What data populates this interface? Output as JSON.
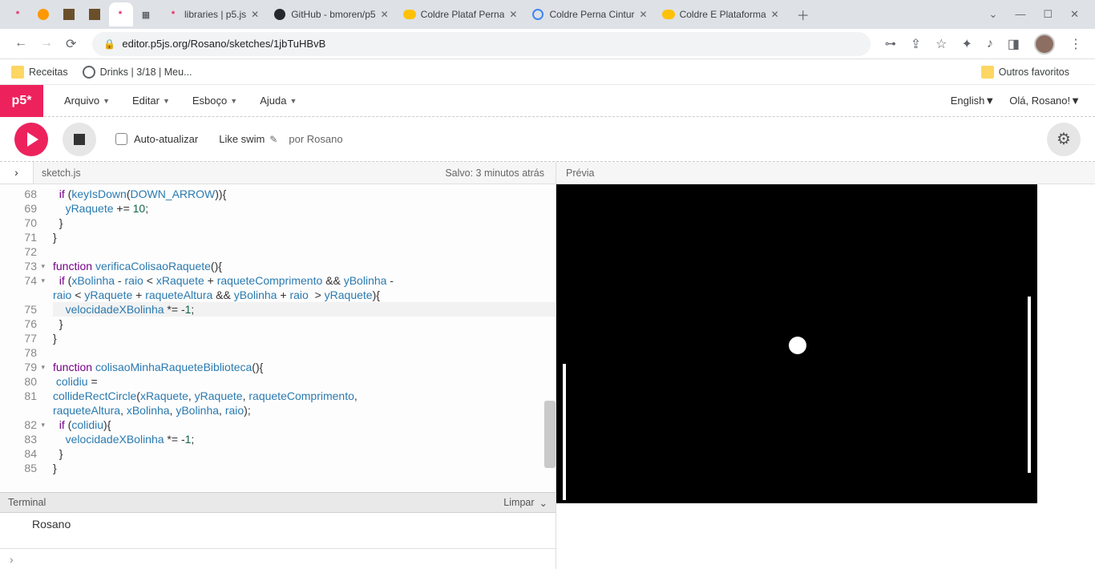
{
  "browser": {
    "tabs": [
      {
        "title": "",
        "fav": "pink"
      },
      {
        "title": "",
        "fav": "orange"
      },
      {
        "title": "",
        "fav": "cube"
      },
      {
        "title": "",
        "fav": "cube"
      },
      {
        "title": "",
        "fav": "pink",
        "active": false
      },
      {
        "title": "",
        "fav": "img"
      },
      {
        "title": "libraries | p5.js",
        "fav": "pink"
      },
      {
        "title": "GitHub - bmoren/p5",
        "fav": "gh"
      },
      {
        "title": "Coldre Plataf Perna",
        "fav": "ml"
      },
      {
        "title": "Coldre Perna Cintur",
        "fav": "g"
      },
      {
        "title": "Coldre E Plataforma",
        "fav": "ml"
      }
    ],
    "url": "editor.p5js.org/Rosano/sketches/1jbTuHBvB",
    "bookmarks": [
      {
        "label": "Receitas",
        "icon": "folder"
      },
      {
        "label": "Drinks | 3/18 | Meu...",
        "icon": "globe"
      }
    ],
    "other_fav": "Outros favoritos"
  },
  "menubar": {
    "items": [
      "Arquivo",
      "Editar",
      "Esboço",
      "Ajuda"
    ],
    "lang": "English",
    "greeting": "Olá, Rosano!"
  },
  "toolbar": {
    "auto": "Auto-atualizar",
    "title": "Like swim",
    "by": "por Rosano"
  },
  "fileheader": {
    "filename": "sketch.js",
    "saved": "Salvo: 3 minutos atrás"
  },
  "code": {
    "lines": [
      {
        "n": "68",
        "fold": false,
        "html": "  <span class='kw'>if</span> (<span class='fn'>keyIsDown</span>(<span class='id'>DOWN_ARROW</span>)){"
      },
      {
        "n": "69",
        "fold": false,
        "html": "    <span class='id'>yRaquete</span> += <span class='num'>10</span>;"
      },
      {
        "n": "70",
        "fold": false,
        "html": "  }"
      },
      {
        "n": "71",
        "fold": false,
        "html": "}"
      },
      {
        "n": "72",
        "fold": false,
        "html": ""
      },
      {
        "n": "73",
        "fold": true,
        "html": "<span class='kw'>function</span> <span class='fn'>verificaColisaoRaquete</span>(){"
      },
      {
        "n": "74",
        "fold": true,
        "html": "  <span class='kw'>if</span> (<span class='id'>xBolinha</span> - <span class='id'>raio</span> &lt; <span class='id'>xRaquete</span> + <span class='id'>raqueteComprimento</span> &amp;&amp; <span class='id'>yBolinha</span> -"
      },
      {
        "n": "",
        "fold": false,
        "html": "<span class='id'>raio</span> &lt; <span class='id'>yRaquete</span> + <span class='id'>raqueteAltura</span> &amp;&amp; <span class='id'>yBolinha</span> + <span class='id'>raio</span>  &gt; <span class='id'>yRaquete</span>){"
      },
      {
        "n": "75",
        "fold": false,
        "hl": true,
        "html": "    <span class='id'>velocidadeXBolinha</span> *= -<span class='num'>1</span>;"
      },
      {
        "n": "76",
        "fold": false,
        "html": "  }"
      },
      {
        "n": "77",
        "fold": false,
        "html": "}"
      },
      {
        "n": "78",
        "fold": false,
        "html": ""
      },
      {
        "n": "79",
        "fold": true,
        "html": "<span class='kw'>function</span> <span class='fn'>colisaoMinhaRaqueteBiblioteca</span>(){"
      },
      {
        "n": "80",
        "fold": false,
        "html": " <span class='id'>colidiu</span> ="
      },
      {
        "n": "81",
        "fold": false,
        "html": "<span class='fn'>collideRectCircle</span>(<span class='id'>xRaquete</span>, <span class='id'>yRaquete</span>, <span class='id'>raqueteComprimento</span>,"
      },
      {
        "n": "",
        "fold": false,
        "html": "<span class='id'>raqueteAltura</span>, <span class='id'>xBolinha</span>, <span class='id'>yBolinha</span>, <span class='id'>raio</span>);"
      },
      {
        "n": "82",
        "fold": true,
        "html": "  <span class='kw'>if</span> (<span class='id'>colidiu</span>){"
      },
      {
        "n": "83",
        "fold": false,
        "html": "    <span class='id'>velocidadeXBolinha</span> *= -<span class='num'>1</span>;"
      },
      {
        "n": "84",
        "fold": false,
        "html": "  }"
      },
      {
        "n": "85",
        "fold": false,
        "html": "}"
      }
    ]
  },
  "terminal": {
    "label": "Terminal",
    "clear": "Limpar",
    "output": "Rosano",
    "prompt": "›"
  },
  "preview": {
    "label": "Prévia"
  }
}
